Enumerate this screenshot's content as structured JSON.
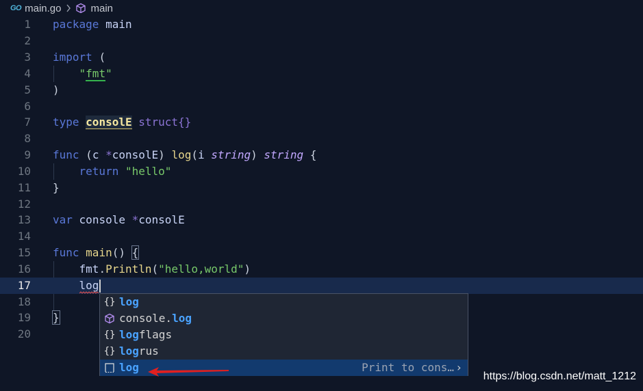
{
  "breadcrumb": {
    "go_logo": "GO",
    "file": "main.go",
    "separator_icon": "chevron-right-icon",
    "package_icon": "cube-icon",
    "package": "main"
  },
  "editor": {
    "current_line": 17,
    "lines": [
      {
        "n": "1"
      },
      {
        "n": "2"
      },
      {
        "n": "3"
      },
      {
        "n": "4"
      },
      {
        "n": "5"
      },
      {
        "n": "6"
      },
      {
        "n": "7"
      },
      {
        "n": "8"
      },
      {
        "n": "9"
      },
      {
        "n": "10"
      },
      {
        "n": "11"
      },
      {
        "n": "12"
      },
      {
        "n": "13"
      },
      {
        "n": "14"
      },
      {
        "n": "15"
      },
      {
        "n": "16"
      },
      {
        "n": "17"
      },
      {
        "n": "18"
      },
      {
        "n": "19"
      },
      {
        "n": "20"
      }
    ],
    "tokens": {
      "package_kw": "package",
      "package_name": "main",
      "import_kw": "import",
      "open_paren": "(",
      "fmt_q1": "\"",
      "fmt_name": "fmt",
      "fmt_q2": "\"",
      "close_paren": ")",
      "type_kw": "type",
      "type_name": "consolE",
      "struct_kw": "struct",
      "struct_braces": "{}",
      "func_kw": "func",
      "recv_open": "(",
      "recv_var": "c",
      "recv_star": "*",
      "recv_type": "consolE",
      "recv_close": ")",
      "method_name": "log",
      "param_open": "(",
      "param_name": "i",
      "param_type": "string",
      "param_close": ")",
      "return_type": "string",
      "open_brace": "{",
      "return_kw": "return",
      "hello_str": "\"hello\"",
      "close_brace": "}",
      "var_kw": "var",
      "var_name": "console",
      "var_star": "*",
      "var_type": "consolE",
      "main_func_kw": "func",
      "main_name": "main",
      "main_parens": "()",
      "main_open_brace": "{",
      "fmt_pkg": "fmt",
      "dot": ".",
      "println": "Println",
      "call_open": "(",
      "hello_world_str": "\"hello,world\"",
      "call_close": ")",
      "typed_text": "log",
      "main_close_brace": "}"
    }
  },
  "suggest": {
    "items": [
      {
        "icon": "braces-icon",
        "icon_text": "{}",
        "prefix": "",
        "match": "log",
        "rest": "",
        "selected": false
      },
      {
        "icon": "cube-icon",
        "icon_text": "",
        "prefix": "console.",
        "match": "log",
        "rest": "",
        "selected": false
      },
      {
        "icon": "braces-icon",
        "icon_text": "{}",
        "prefix": "",
        "match": "log",
        "rest": "flags",
        "selected": false
      },
      {
        "icon": "braces-icon",
        "icon_text": "{}",
        "prefix": "",
        "match": "log",
        "rest": "rus",
        "selected": false
      },
      {
        "icon": "snippet-icon",
        "icon_text": "",
        "prefix": "",
        "match": "log",
        "rest": "",
        "selected": true
      }
    ],
    "selected_detail": "Print to cons…",
    "more_icon": "chevron-right-icon",
    "more_glyph": "›"
  },
  "annotation": {
    "arrow_icon": "red-arrow-icon",
    "arrow_color": "#e02020"
  },
  "watermark": "https://blog.csdn.net/matt_1212",
  "colors": {
    "background": "#0f1626",
    "current_line": "#182a4c",
    "keyword": "#5a78d8",
    "string": "#78c96a",
    "function": "#e7d68c",
    "match": "#4aa3ff"
  }
}
